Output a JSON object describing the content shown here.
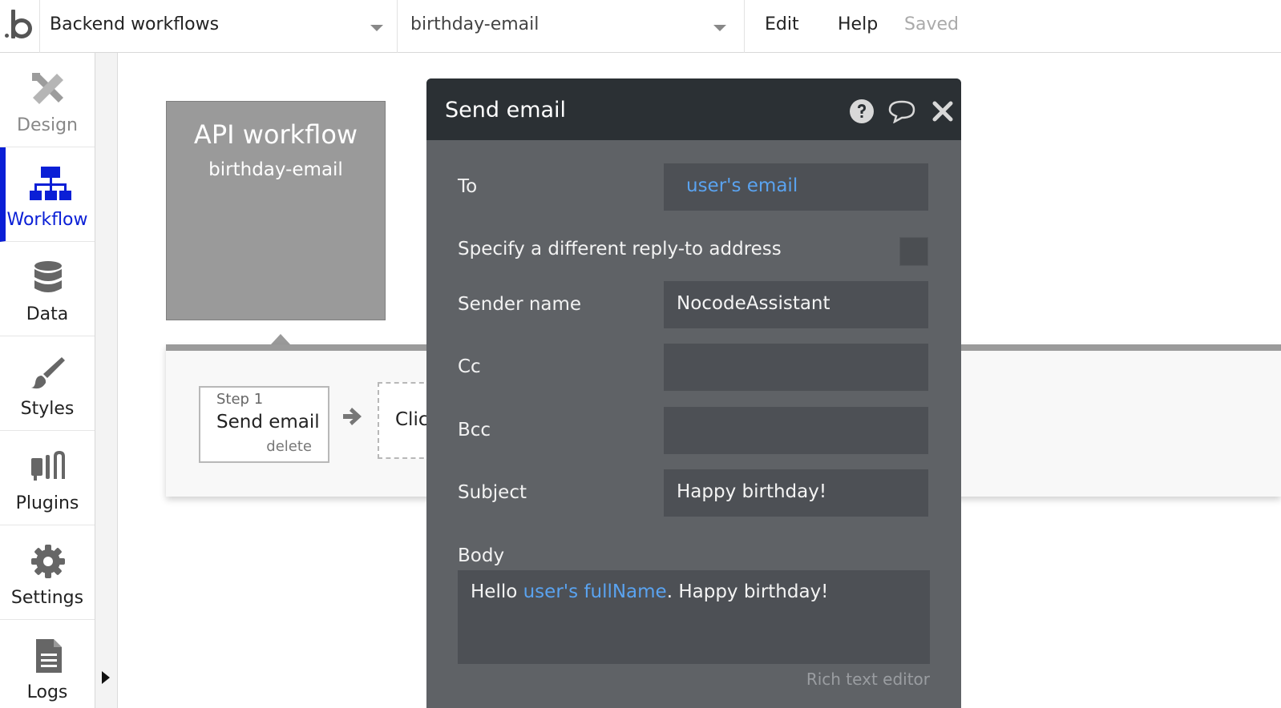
{
  "topbar": {
    "page_dropdown": "Backend workflows",
    "workflow_dropdown": "birthday-email",
    "menu": {
      "edit": "Edit",
      "help": "Help"
    },
    "status": "Saved"
  },
  "sidebar": {
    "items": [
      {
        "label": "Design",
        "icon": "design-icon"
      },
      {
        "label": "Workflow",
        "icon": "workflow-icon"
      },
      {
        "label": "Data",
        "icon": "database-icon"
      },
      {
        "label": "Styles",
        "icon": "brush-icon"
      },
      {
        "label": "Plugins",
        "icon": "plug-icon"
      },
      {
        "label": "Settings",
        "icon": "gear-icon"
      },
      {
        "label": "Logs",
        "icon": "document-icon"
      }
    ],
    "active_item": "Workflow"
  },
  "canvas": {
    "api_box": {
      "title": "API workflow",
      "subtitle": "birthday-email"
    },
    "step1": {
      "step_label": "Step 1",
      "action": "Send email",
      "delete": "delete"
    },
    "next_step_text": "Click"
  },
  "dialog": {
    "title": "Send email",
    "fields": {
      "to": {
        "label": "To",
        "value": "user's email"
      },
      "reply_to": {
        "label": "Specify a different reply-to address"
      },
      "sender_name": {
        "label": "Sender name",
        "value": "NocodeAssistant"
      },
      "cc": {
        "label": "Cc",
        "value": ""
      },
      "bcc": {
        "label": "Bcc",
        "value": ""
      },
      "subject": {
        "label": "Subject",
        "value": "Happy birthday!"
      },
      "body": {
        "label": "Body",
        "prefix": "Hello ",
        "dynamic": "user's fullName",
        "suffix": ". Happy birthday!"
      }
    },
    "rich_text_editor_label": "Rich text editor"
  },
  "colors": {
    "accent_active": "#0a1fd6",
    "dynamic_expression": "#5aa3f0",
    "dialog_header": "#2b3034",
    "dialog_body": "#5f6266"
  }
}
